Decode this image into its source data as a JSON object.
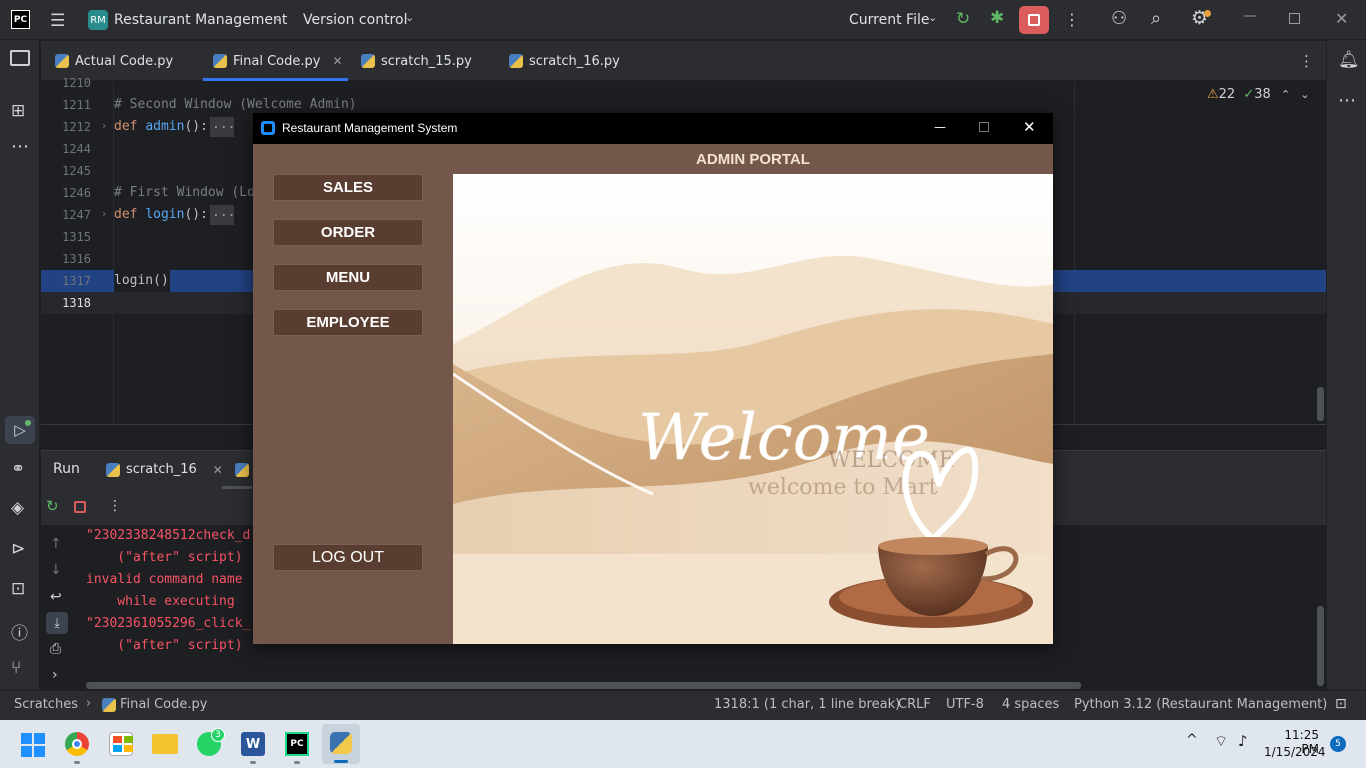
{
  "titlebar": {
    "logo": "PC",
    "project_badge": "RM",
    "project_name": "Restaurant Management",
    "vcs": "Version control",
    "run_config": "Current File"
  },
  "tabs": [
    {
      "label": "Actual Code.py"
    },
    {
      "label": "Final Code.py"
    },
    {
      "label": "scratch_15.py"
    },
    {
      "label": "scratch_16.py"
    }
  ],
  "inspections": {
    "warnings": "22",
    "checks": "38"
  },
  "editor": {
    "lines": [
      {
        "num": "1210",
        "code": ""
      },
      {
        "num": "1211",
        "code": "# Second Window (Welcome Admin)"
      },
      {
        "num": "1212",
        "code": "def admin():"
      },
      {
        "num": "1244",
        "code": ""
      },
      {
        "num": "1245",
        "code": ""
      },
      {
        "num": "1246",
        "code": "# First Window (Lo"
      },
      {
        "num": "1247",
        "code": "def login():"
      },
      {
        "num": "1315",
        "code": ""
      },
      {
        "num": "1316",
        "code": ""
      },
      {
        "num": "1317",
        "code": "login()"
      },
      {
        "num": "1318",
        "code": ""
      }
    ],
    "fold": "..."
  },
  "run": {
    "title": "Run",
    "tab": "scratch_16",
    "output": [
      "\"2302338248512check_d",
      "    (\"after\" script)",
      "invalid command name",
      "    while executing",
      "\"2302361055296_click_",
      "    (\"after\" script)"
    ]
  },
  "status": {
    "breadcrumb_root": "Scratches",
    "breadcrumb_file": "Final Code.py",
    "position": "1318:1 (1 char, 1 line break)",
    "line_sep": "CRLF",
    "encoding": "UTF-8",
    "indent": "4 spaces",
    "interpreter": "Python 3.12 (Restaurant Management)"
  },
  "tk": {
    "title": "Restaurant Management System",
    "header": "ADMIN PORTAL",
    "buttons": [
      "SALES",
      "ORDER",
      "MENU",
      "EMPLOYEE"
    ],
    "logout": "LOG OUT",
    "welcome": "Welcome",
    "watermark1": "WELCOME",
    "watermark2": "welcome to Mart"
  },
  "taskbar": {
    "time": "11:25 PM",
    "date": "1/15/2024",
    "whatsapp_badge": "3",
    "notif_badge": "5",
    "word_letter": "W",
    "pc_letter": "PC"
  }
}
